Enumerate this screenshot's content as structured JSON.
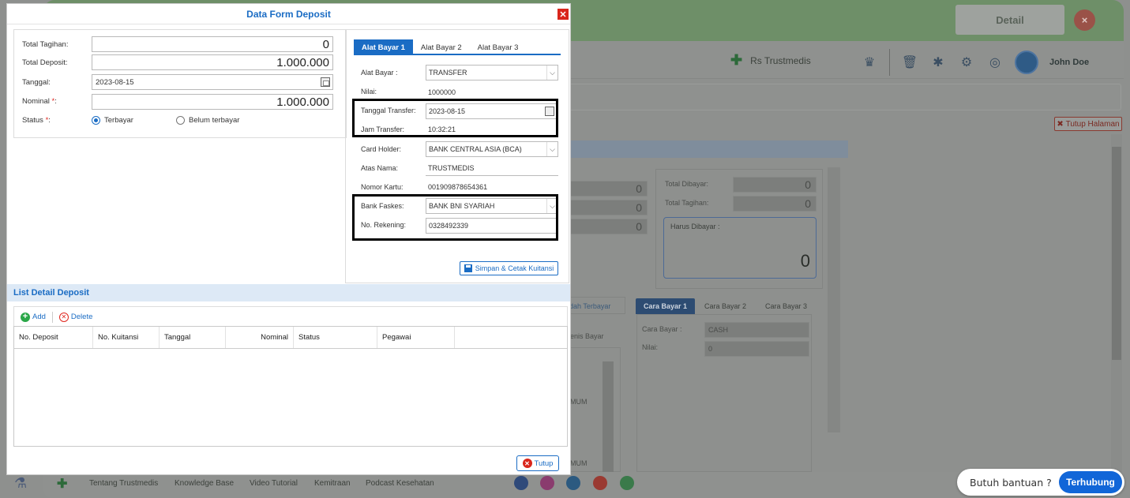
{
  "background": {
    "detail_button": "Detail",
    "close_label": "×",
    "hospital_name": "Rs Trustmedis",
    "user_name": "John Doe",
    "tutup_halaman": "Tutup Halaman",
    "fields": [
      "0",
      "0",
      "0"
    ],
    "total_dibayar_label": "Total Dibayar:",
    "total_dibayar_value": "0",
    "total_tagihan_label": "Total Tagihan:",
    "total_tagihan_value": "0",
    "harus_dibayar_label": "Harus Dibayar :",
    "harus_dibayar_value": "0",
    "sudah_terbayar_tab": "dah Terbayar",
    "jenis_bayar_header": "enis Bayar",
    "umum_1": "MUM",
    "umum_2": "MUM",
    "cara_tabs": [
      "Cara Bayar 1",
      "Cara Bayar 2",
      "Cara Bayar 3"
    ],
    "cara_bayar_label": "Cara Bayar :",
    "cara_bayar_value": "CASH",
    "nilai_label": "Nilai:",
    "nilai_value": "0",
    "footer_links": [
      "Tentang Trustmedis",
      "Knowledge Base",
      "Video Tutorial",
      "Kemitraan",
      "Podcast Kesehatan"
    ],
    "colors": {
      "header_green": "#6e8f68",
      "dim": "#8e908e"
    }
  },
  "help": {
    "text": "Butuh bantuan ?",
    "button": "Terhubung"
  },
  "modal": {
    "title": "Data Form Deposit",
    "close_label": "✕",
    "form": {
      "total_tagihan_label": "Total Tagihan:",
      "total_tagihan_value": "0",
      "total_deposit_label": "Total Deposit:",
      "total_deposit_value": "1.000.000",
      "tanggal_label": "Tanggal:",
      "tanggal_value": "2023-08-15",
      "nominal_label": "Nominal ",
      "nominal_value": "1.000.000",
      "status_label": "Status ",
      "required_mark": "*",
      "colon": ":",
      "status_options": [
        "Terbayar",
        "Belum terbayar"
      ],
      "status_selected": "Terbayar"
    },
    "payment": {
      "tabs": [
        "Alat Bayar 1",
        "Alat Bayar 2",
        "Alat Bayar 3"
      ],
      "active_tab": "Alat Bayar 1",
      "alat_bayar_label": "Alat Bayar :",
      "alat_bayar_value": "TRANSFER",
      "nilai_label": "Nilai:",
      "nilai_value": "1000000",
      "tanggal_transfer_label": "Tanggal Transfer:",
      "tanggal_transfer_value": "2023-08-15",
      "jam_transfer_label": "Jam Transfer:",
      "jam_transfer_value": "10:32:21",
      "card_holder_label": "Card Holder:",
      "card_holder_value": "BANK CENTRAL ASIA (BCA)",
      "atas_nama_label": "Atas Nama:",
      "atas_nama_value": "TRUSTMEDIS",
      "nomor_kartu_label": "Nomor Kartu:",
      "nomor_kartu_value": "001909878654361",
      "bank_faskes_label": "Bank Faskes:",
      "bank_faskes_value": "BANK BNI SYARIAH",
      "no_rekening_label": "No. Rekening:",
      "no_rekening_value": "0328492339",
      "save_button": "Simpan & Cetak Kuitansi"
    },
    "list": {
      "title": "List Detail Deposit",
      "add_button": "Add",
      "delete_button": "Delete",
      "columns": [
        "No. Deposit",
        "No. Kuitansi",
        "Tanggal",
        "Nominal",
        "Status",
        "Pegawai",
        ""
      ]
    },
    "close_button": "Tutup",
    "colors": {
      "accent": "#1a6cc4",
      "danger": "#d9261c",
      "success": "#2aa748"
    }
  }
}
